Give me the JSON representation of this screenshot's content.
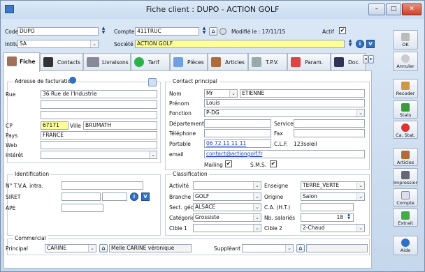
{
  "window": {
    "title": "Fiche client : DUPO - ACTION  GOLF",
    "minimize": "–",
    "maximize": "□",
    "close": "✕"
  },
  "header": {
    "code_label": "Code",
    "code_value": "DUPO",
    "compte_label": "Compte",
    "compte_value": "411TRUC",
    "modifie": "Modifié le : 17/11/15",
    "actif_label": "Actif",
    "actif_checked": "✔",
    "intitule_label": "Intitulé",
    "intitule_value": "SA",
    "societe_label": "Société",
    "societe_value": "ACTION  GOLF"
  },
  "tabs": [
    {
      "label": "Fiche"
    },
    {
      "label": "Contacts"
    },
    {
      "label": "Livraisons"
    },
    {
      "label": "Tarif"
    },
    {
      "label": "Pièces"
    },
    {
      "label": "Articles"
    },
    {
      "label": "T.P.V."
    },
    {
      "label": "Param."
    },
    {
      "label": "Doc."
    }
  ],
  "tab_scroll": {
    "left": "◂",
    "right": "▸"
  },
  "billing": {
    "title": "Adresse de facturation",
    "rue_label": "Rue",
    "rue1": "36 Rue de l'Industrie",
    "rue2": "",
    "rue3": "",
    "cp_label": "CP",
    "cp_value": "67171",
    "ville_label": "Ville",
    "ville_value": "BRUMATH",
    "pays_label": "Pays",
    "pays_value": "FRANCE",
    "web_label": "Web",
    "web_value": "",
    "interet_label": "Intérêt",
    "interet_value": ""
  },
  "contact": {
    "title": "Contact principal",
    "nom_label": "Nom",
    "civilite": "Mr",
    "nom_value": "ETIENNE",
    "prenom_label": "Prénom",
    "prenom_value": "Louis",
    "fonction_label": "Fonction",
    "fonction_value": "P-DG",
    "departement_label": "Département",
    "departement_value": "",
    "service_label": "Service",
    "service_value": "",
    "telephone_label": "Téléphone",
    "telephone_value": "",
    "fax_label": "Fax",
    "fax_value": "",
    "portable_label": "Portable",
    "portable_value": "06 72 11 11 11",
    "clf_label": "C.L.F.",
    "clf_value": "123soleil",
    "email_label": "email",
    "email_value": "contact@actiongolf.fr",
    "mailing_label": "Mailing",
    "sms_label": "S.M.S."
  },
  "identification": {
    "title": "Identification",
    "tva_label": "N° T.V.A. intra.",
    "tva_value": "",
    "siret_label": "SIRET",
    "siret1": "",
    "siret2": "",
    "ape_label": "APE",
    "ape_value": ""
  },
  "classification": {
    "title": "Classification",
    "activite_label": "Activité",
    "activite_value": "",
    "enseigne_label": "Enseigne",
    "enseigne_value": "TERRE_VERTE",
    "branche_label": "Branche",
    "branche_value": "GOLF",
    "origine_label": "Origine",
    "origine_value": "Salon",
    "sectgeo_label": "Sect. géo.",
    "sectgeo_value": "ALSACE",
    "ca_label": "C.A. (H.T.)",
    "ca_value": "",
    "categorie_label": "Catégorie",
    "categorie_value": "Grossiste",
    "nbsal_label": "Nb. salariés",
    "nbsal_value": "18",
    "cible1_label": "Cible 1",
    "cible1_value": "",
    "cible2_label": "Cible 2",
    "cible2_value": "2-Chaud"
  },
  "commercial": {
    "title": "Commercial",
    "principal_label": "Principal",
    "principal_value": "CARINE",
    "principal_name": "Melle CARINE véronique",
    "suppleant_label": "Suppléant",
    "suppleant_value": ""
  },
  "sidebar": [
    {
      "label": "OK"
    },
    {
      "label": "Annuler"
    },
    {
      "label": "Recoder"
    },
    {
      "label": "Stats"
    },
    {
      "label": "Ca. Stat."
    },
    {
      "label": "Articles"
    },
    {
      "label": "Impressior"
    },
    {
      "label": "Compte"
    },
    {
      "label": "Extrait"
    },
    {
      "label": "Aide"
    }
  ],
  "icons": {
    "check": "✔",
    "arrow_down": "⌄",
    "info": "i",
    "v": "V",
    "home": "⌂"
  }
}
